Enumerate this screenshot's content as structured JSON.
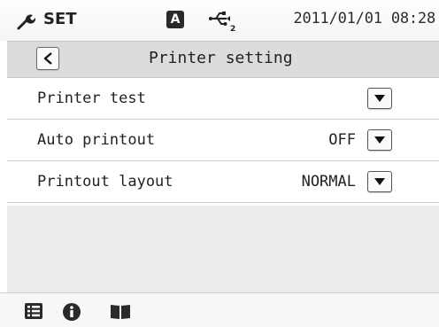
{
  "status_bar": {
    "icon": "wrench-icon",
    "mode_label": "SET",
    "badge": "A",
    "usb_icon": "usb-2-icon",
    "datetime": "2011/01/01 08:28"
  },
  "title_bar": {
    "back_icon": "chevron-left-icon",
    "title": "Printer setting"
  },
  "settings": [
    {
      "label": "Printer test",
      "value": ""
    },
    {
      "label": "Auto printout",
      "value": "OFF"
    },
    {
      "label": "Printout layout",
      "value": "NORMAL"
    }
  ],
  "bottom_bar": {
    "icons": [
      "list-icon",
      "info-icon",
      "book-icon"
    ]
  },
  "colors": {
    "title_bar_bg": "#dcdcdc",
    "empty_area_bg": "#ececec",
    "badge_bg": "#2a2a2a"
  }
}
